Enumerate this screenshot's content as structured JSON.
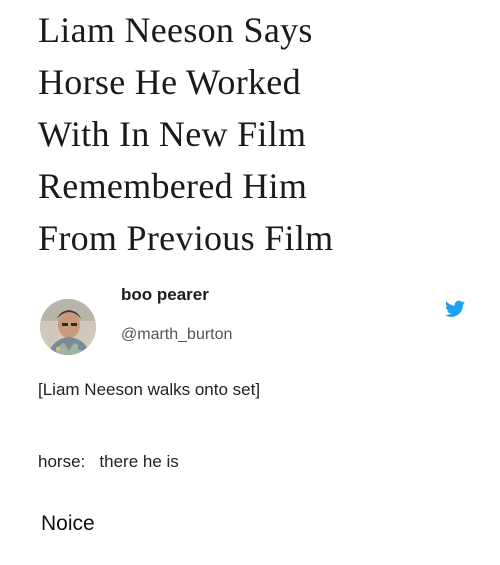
{
  "headline": {
    "lines": [
      "Liam Neeson Says",
      "Horse He Worked",
      "With In New Film",
      "Remembered Him",
      "From Previous Film"
    ]
  },
  "tweet": {
    "display_name": "boo pearer",
    "handle": "@marth_burton",
    "avatar_icon": "user-avatar-photo",
    "platform_icon": "twitter-bird-icon",
    "platform_color": "#1da1f2",
    "lines": [
      "[Liam Neeson walks onto set]",
      "horse:   there he is"
    ]
  },
  "caption": "Noice"
}
